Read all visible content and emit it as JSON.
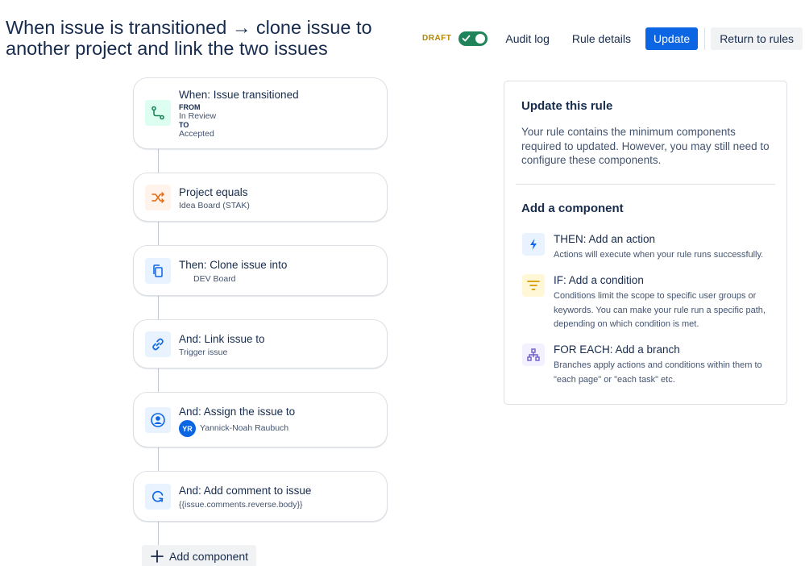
{
  "title": "When issue is transitioned → clone issue to another project and link the two issues",
  "toolbar": {
    "draft_label": "DRAFT",
    "audit_log": "Audit log",
    "rule_details": "Rule details",
    "update": "Update",
    "return_to_rules": "Return to rules"
  },
  "rule": {
    "trigger": {
      "title": "When: Issue transitioned",
      "from_label": "FROM",
      "from_value": "In Review",
      "to_label": "TO",
      "to_value": "Accepted",
      "icon": "transition-icon"
    },
    "condition": {
      "title": "Project equals",
      "sub": "Idea Board (STAK)",
      "icon": "shuffle-icon"
    },
    "clone": {
      "title": "Then: Clone issue into",
      "sub": "DEV Board",
      "icon": "copy-icon"
    },
    "link": {
      "title": "And: Link issue to",
      "sub": "Trigger issue",
      "icon": "link-icon"
    },
    "assign": {
      "title": "And: Assign the issue to",
      "avatar": "YR",
      "user": "Yannick-Noah Raubuch",
      "icon": "user-circle-icon"
    },
    "comment": {
      "title": "And: Add comment to issue",
      "sub": "{{issue.comments.reverse.body}}",
      "icon": "comment-refresh-icon"
    }
  },
  "add_component_label": "Add component",
  "panel": {
    "title": "Update this rule",
    "description": "Your rule contains the minimum components required to updated. However, you may still need to configure these components.",
    "add_title": "Add a component",
    "components": [
      {
        "title": "THEN: Add an action",
        "desc": "Actions will execute when your rule runs successfully.",
        "icon": "lightning-icon",
        "color": "#0c66e4"
      },
      {
        "title": "IF: Add a condition",
        "desc": "Conditions limit the scope to specific user groups or keywords. You can make your rule run a specific path, depending on which condition is met.",
        "icon": "filter-icon",
        "color": "#e2b203"
      },
      {
        "title": "FOR EACH: Add a branch",
        "desc": "Branches apply actions and conditions within them to \"each page\" or \"each task\" etc.",
        "icon": "branch-icon",
        "color": "#6e5dc6"
      }
    ]
  },
  "colors": {
    "primary": "#0c66e4",
    "toggle_on": "#1f845a",
    "draft": "#b38600",
    "trigger_icon_bg": "#dcfff1",
    "condition_icon_bg": "#fff3eb",
    "action_icon_bg": "#e9f2ff"
  }
}
